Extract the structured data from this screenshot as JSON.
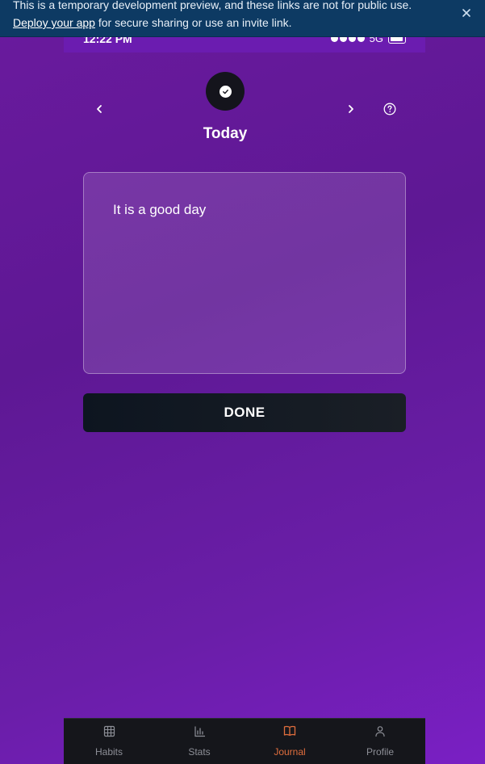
{
  "banner": {
    "message": "This is a temporary development preview, and these links are not for public use.",
    "link_text": "Deploy your app",
    "suffix_text": " for secure sharing or use an invite link.",
    "close_icon": "close-icon"
  },
  "status_bar": {
    "time": "12:22 PM",
    "network": "5G"
  },
  "header": {
    "title": "Today",
    "prev_icon": "chevron-left-icon",
    "next_icon": "chevron-right-icon",
    "help_icon": "help-circle-icon",
    "logo_icon": "check-badge-icon"
  },
  "journal": {
    "entry_text": "It is a good day"
  },
  "done_button": {
    "label": "DONE"
  },
  "tabs": [
    {
      "label": "Habits",
      "icon": "grid-icon",
      "active": false
    },
    {
      "label": "Stats",
      "icon": "bar-chart-icon",
      "active": false
    },
    {
      "label": "Journal",
      "icon": "book-open-icon",
      "active": true
    },
    {
      "label": "Profile",
      "icon": "user-icon",
      "active": false
    }
  ],
  "colors": {
    "accent": "#e06e3d",
    "banner_bg": "#0d3a63",
    "background": "#6a1a9e",
    "tab_bar_bg": "#15161b"
  }
}
